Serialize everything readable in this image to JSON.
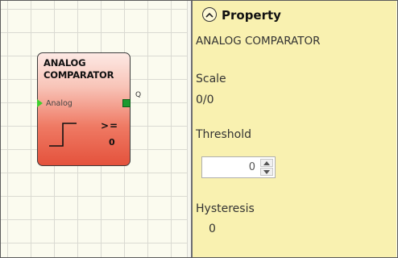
{
  "block": {
    "title": "ANALOG\nCOMPARATOR",
    "input_label": "Analog",
    "output_label": "Q",
    "operator": ">=",
    "threshold_display": "0",
    "icons": {
      "input": "input-arrow-icon",
      "output": "output-port-icon",
      "step": "step-function-icon"
    },
    "colors": {
      "gradient_top": "#fde9e4",
      "gradient_bottom": "#e4523c",
      "input_port": "#3fcf2e",
      "output_port": "#1b9a2f"
    }
  },
  "property_panel": {
    "title": "Property",
    "collapse_icon": "chevron-up-icon",
    "block_name": "ANALOG COMPARATOR",
    "scale": {
      "label": "Scale",
      "value": "0/0"
    },
    "threshold": {
      "label": "Threshold",
      "value": "0"
    },
    "hysteresis": {
      "label": "Hysteresis",
      "value": "0"
    },
    "background_color": "#f9f1b0"
  }
}
